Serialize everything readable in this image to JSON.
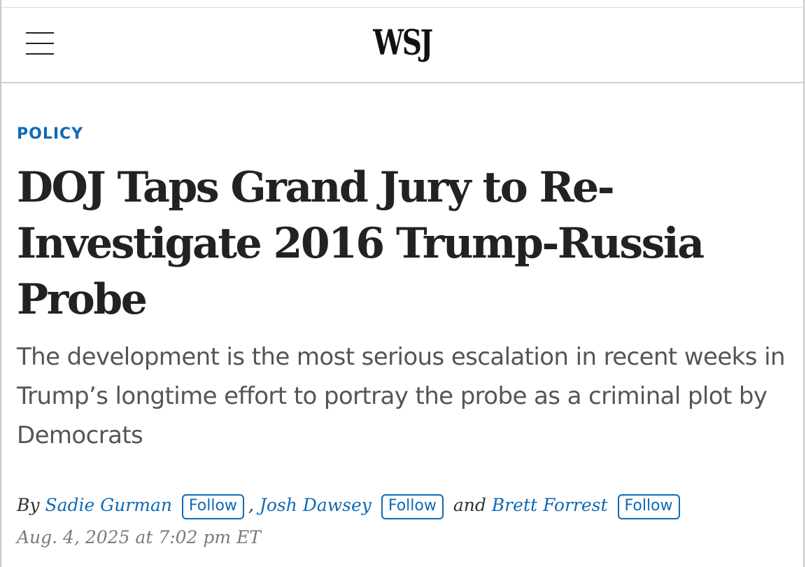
{
  "header": {
    "logo": "WSJ",
    "menu_icon": "hamburger-menu-icon"
  },
  "article": {
    "section": "POLICY",
    "headline": "DOJ Taps Grand Jury to Re-Investigate 2016 Trump-Russia Probe",
    "dek": "The development is the most serious escalation in recent weeks in Trump’s longtime effort to portray the probe as a criminal plot by Democrats",
    "byline": {
      "prefix": "By",
      "authors": [
        {
          "name": "Sadie Gurman",
          "follow_label": "Follow"
        },
        {
          "name": "Josh Dawsey",
          "follow_label": "Follow"
        },
        {
          "name": "Brett Forrest",
          "follow_label": "Follow"
        }
      ],
      "separator": ",",
      "conjunction": "and"
    },
    "date": "Aug. 4, 2025 at 7:02 pm ET"
  },
  "colors": {
    "accent": "#0f6ab4",
    "headline": "#222222",
    "dek": "#555555",
    "date": "#7a7a7a"
  }
}
